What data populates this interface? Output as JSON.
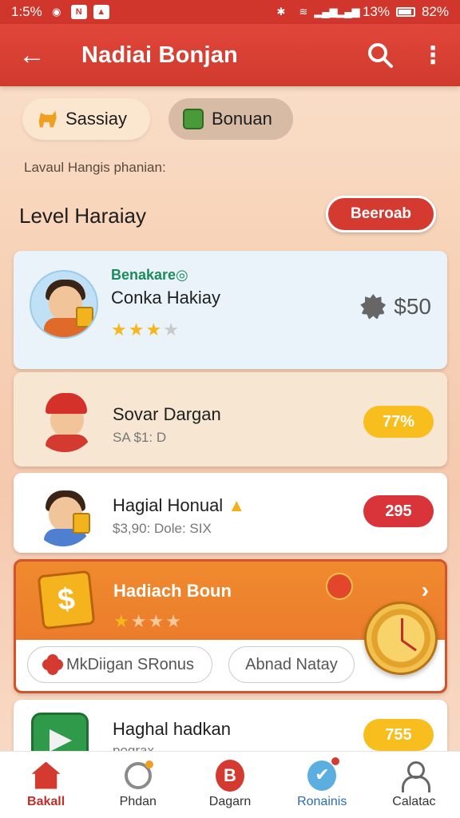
{
  "status_bar": {
    "time": "1:5%",
    "right_text": "13%",
    "battery": "82%"
  },
  "app_bar": {
    "title": "Nadiai Bonjan"
  },
  "chips": [
    {
      "label": "Sassiay",
      "icon": "dog-icon"
    },
    {
      "label": "Bonuan",
      "icon": "note-icon"
    }
  ],
  "subtitle": "Lavaul Hangis phanian:",
  "section": {
    "title": "Level Haraiay",
    "button": "Beeroab"
  },
  "cards": [
    {
      "tag": "Benakare◎",
      "title": "Conka Hakiay",
      "stars_filled": 3,
      "stars_total": 4,
      "price": "$50",
      "price_icon": "gear-icon"
    },
    {
      "title": "Sovar Dargan",
      "sub": "SA $1: D",
      "badge": "77%"
    },
    {
      "title": "Hagial Honual",
      "sub": "$3,90: Dole: SIX",
      "badge": "295"
    },
    {
      "title": "Hadiach Boun",
      "stars_filled": 1,
      "stars_total": 4,
      "icon": "bonus-dollar-icon",
      "pill_1": "MkDiigan SRonus",
      "pill_2": "Abnad Natay"
    },
    {
      "title": "Haghal hadkan",
      "sub": "pograx",
      "badge": "755"
    }
  ],
  "bottom_nav": [
    {
      "label": "Bakall",
      "icon": "home-icon"
    },
    {
      "label": "Phdan",
      "icon": "chat-icon"
    },
    {
      "label": "Dagarn",
      "icon": "b-icon",
      "glyph": "B"
    },
    {
      "label": "Ronainis",
      "icon": "check-icon"
    },
    {
      "label": "Calatac",
      "icon": "person-icon"
    }
  ],
  "colors": {
    "primary": "#d0362c",
    "accent_orange": "#e8732a",
    "badge_yellow": "#f7be1e",
    "badge_red": "#d8343a"
  }
}
